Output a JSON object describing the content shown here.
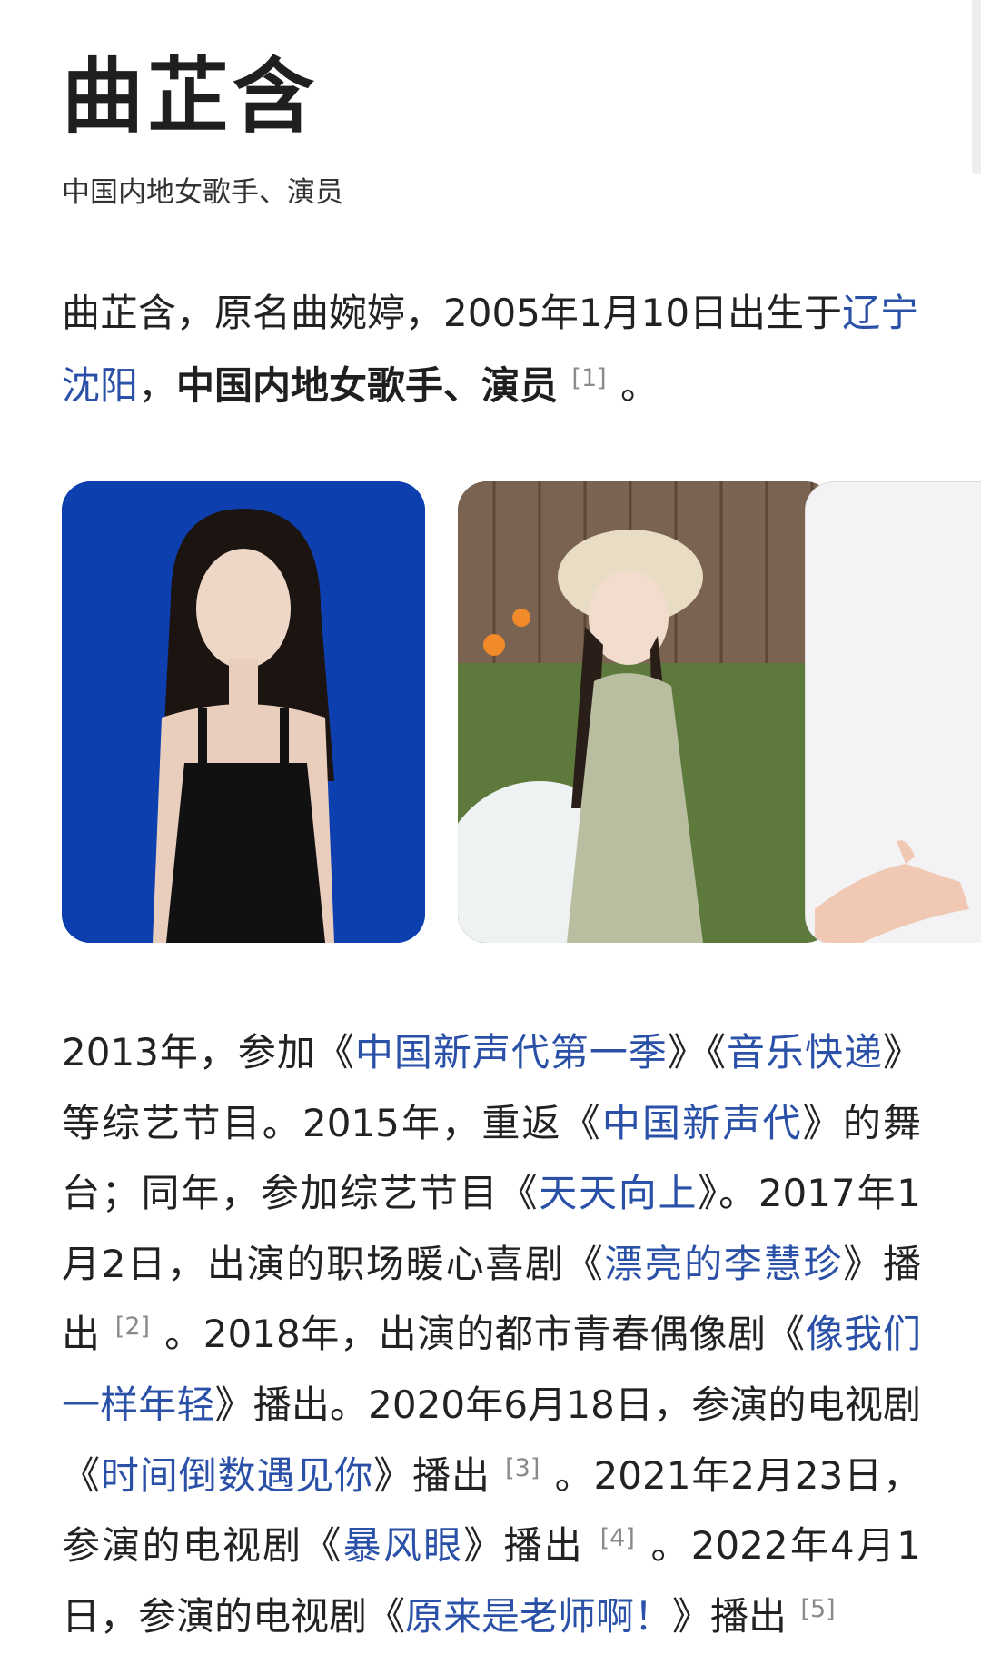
{
  "article": {
    "title": "曲芷含",
    "subtitle": "中国内地女歌手、演员"
  },
  "intro": {
    "t1": "曲芷含，原名曲婉婷，2005年1月10日出生于",
    "link1": "辽宁沈阳",
    "t2": "，",
    "bold1": "中国内地女歌手、演员",
    "ref1": "[1]",
    "t3": "。"
  },
  "gallery": {
    "photos": [
      {
        "name": "photo-black-dress",
        "background": "#0d3fae"
      },
      {
        "name": "photo-sun-hat-garden",
        "background": "#6f5a48"
      },
      {
        "name": "photo-hand-white-background",
        "background": "#f1f1f4"
      }
    ]
  },
  "body": {
    "s01": "2013年，参加《",
    "l01": "中国新声代第一季",
    "s02": "》《",
    "l02": "音乐快递",
    "s03": "》等综艺节目。2015年，重返《",
    "l03": "中国新声代",
    "s04": "》的舞台；同年，参加综艺节目《",
    "l04": "天天向上",
    "s05": "》。2017年1月2日，出演的职场暖心喜剧《",
    "l05": "漂亮的李慧珍",
    "s06": "》播出",
    "r2": "[2]",
    "s07": "。2018年，出演的都市青春偶像剧《",
    "l06": "像我们一样年轻",
    "s08": "》播出。2020年6月18日，参演的电视剧《",
    "l07": "时间倒数遇见你",
    "s09": "》播出",
    "r3": "[3]",
    "s10": "。2021年2月23日，参演的电视剧《",
    "l08": "暴风眼",
    "s11": "》播出",
    "r4": "[4]",
    "s12": "。2022年4月1日，参演的电视剧《",
    "l09": "原来是老师啊！",
    "s13": "》播出",
    "r5": "[5]"
  },
  "colors": {
    "link": "#2a50a8",
    "text": "#222222",
    "reference": "#8a8a8a"
  }
}
